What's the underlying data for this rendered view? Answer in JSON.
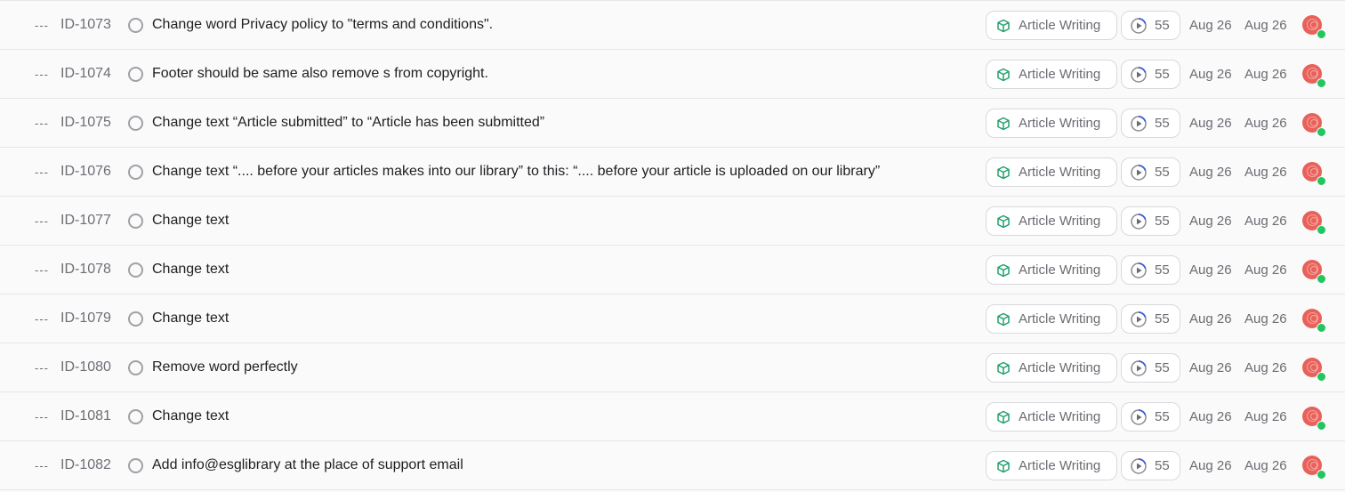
{
  "issues": [
    {
      "priority": "---",
      "id": "ID-1073",
      "title": "Change word Privacy policy to \"terms and conditions\".",
      "label": "Article Writing",
      "estimate": "55",
      "start_date": "Aug 26",
      "due_date": "Aug 26"
    },
    {
      "priority": "---",
      "id": "ID-1074",
      "title": "Footer should be same also remove s from copyright.",
      "label": "Article Writing",
      "estimate": "55",
      "start_date": "Aug 26",
      "due_date": "Aug 26"
    },
    {
      "priority": "---",
      "id": "ID-1075",
      "title": "Change text “Article submitted” to “Article has been submitted”",
      "label": "Article Writing",
      "estimate": "55",
      "start_date": "Aug 26",
      "due_date": "Aug 26"
    },
    {
      "priority": "---",
      "id": "ID-1076",
      "title": "Change text “.... before your articles makes into our library” to this: “.... before your article is uploaded on our library”",
      "label": "Article Writing",
      "estimate": "55",
      "start_date": "Aug 26",
      "due_date": "Aug 26"
    },
    {
      "priority": "---",
      "id": "ID-1077",
      "title": "Change text",
      "label": "Article Writing",
      "estimate": "55",
      "start_date": "Aug 26",
      "due_date": "Aug 26"
    },
    {
      "priority": "---",
      "id": "ID-1078",
      "title": "Change text",
      "label": "Article Writing",
      "estimate": "55",
      "start_date": "Aug 26",
      "due_date": "Aug 26"
    },
    {
      "priority": "---",
      "id": "ID-1079",
      "title": "Change text",
      "label": "Article Writing",
      "estimate": "55",
      "start_date": "Aug 26",
      "due_date": "Aug 26"
    },
    {
      "priority": "---",
      "id": "ID-1080",
      "title": "Remove word perfectly",
      "label": "Article Writing",
      "estimate": "55",
      "start_date": "Aug 26",
      "due_date": "Aug 26"
    },
    {
      "priority": "---",
      "id": "ID-1081",
      "title": "Change text",
      "label": "Article Writing",
      "estimate": "55",
      "start_date": "Aug 26",
      "due_date": "Aug 26"
    },
    {
      "priority": "---",
      "id": "ID-1082",
      "title": "Add info@esglibrary at the place of support email",
      "label": "Article Writing",
      "estimate": "55",
      "start_date": "Aug 26",
      "due_date": "Aug 26"
    }
  ],
  "icons": {
    "priority": "no-priority-icon",
    "status": "status-circle-icon",
    "label": "cube-icon",
    "estimate": "cycle-clock-icon",
    "assignee": "avatar",
    "presence": "online-dot"
  },
  "colors": {
    "label_icon": "#22a06b",
    "estimate_icon_accent": "#3b5bdb",
    "avatar": "#e8615a",
    "online": "#22c55e"
  }
}
